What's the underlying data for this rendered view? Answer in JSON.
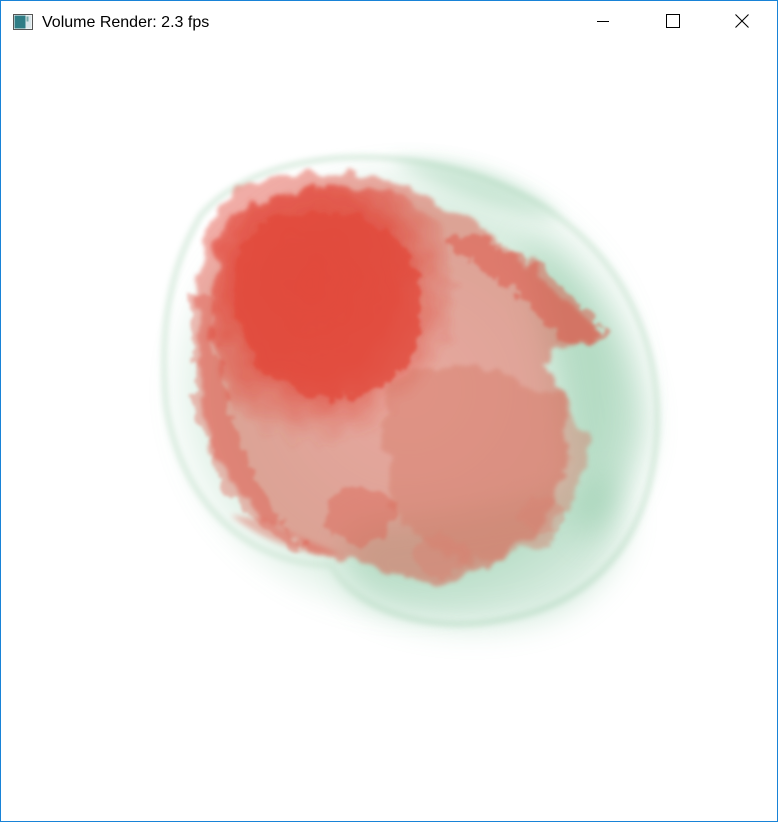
{
  "window": {
    "title": "Volume Render: 2.3 fps",
    "controls": {
      "minimize_icon": "minimize-icon",
      "maximize_icon": "maximize-icon",
      "close_icon": "close-icon"
    }
  },
  "colors": {
    "window_border": "#1883d7",
    "background": "#ffffff",
    "volume_red": "#e04a3a",
    "volume_green": "#7fc19a"
  }
}
